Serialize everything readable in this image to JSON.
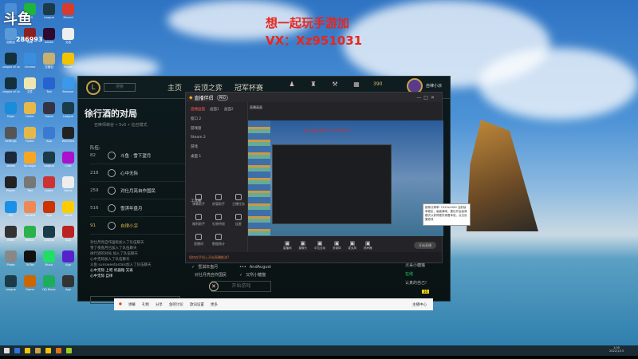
{
  "overlay": {
    "line1": "想一起玩手游加",
    "line2": "VX：Xz951031",
    "channel_logo": "斗鱼",
    "room_number": "286993"
  },
  "desktop": {
    "icons": [
      {
        "label": "此电脑",
        "color": "#4a8fd8"
      },
      {
        "label": "360",
        "color": "#1eb53a"
      },
      {
        "label": "League",
        "color": "#1c3b48"
      },
      {
        "label": "Record",
        "color": "#d83b2c"
      },
      {
        "label": "回收站",
        "color": "#5a9ad8"
      },
      {
        "label": "App",
        "color": "#8a2020"
      },
      {
        "label": "Adobe",
        "color": "#2e0a2f"
      },
      {
        "label": "文档",
        "color": "#eeeeee"
      },
      {
        "label": "League of Legends",
        "color": "#14303a"
      },
      {
        "label": "Chrome",
        "color": "#3b8ede"
      },
      {
        "label": "压缩包",
        "color": "#c8b06e"
      },
      {
        "label": "Player",
        "color": "#f2c300"
      },
      {
        "label": "League of Legends",
        "color": "#14303a"
      },
      {
        "label": "文件",
        "color": "#f0e6b0"
      },
      {
        "label": "Tool",
        "color": "#2463d0"
      },
      {
        "label": "Browser",
        "color": "#3a99e8"
      },
      {
        "label": "Edge",
        "color": "#1b8cd8"
      },
      {
        "label": "Folder",
        "color": "#e6b84a"
      },
      {
        "label": "Game",
        "color": "#334"
      },
      {
        "label": "League",
        "color": "#1c3b48"
      },
      {
        "label": "Settings",
        "color": "#555"
      },
      {
        "label": "Folder",
        "color": "#e6b84a"
      },
      {
        "label": "App",
        "color": "#3a7ad0"
      },
      {
        "label": "WeGame",
        "color": "#222"
      },
      {
        "label": "Steam",
        "color": "#1b2838"
      },
      {
        "label": "Sunlogin",
        "color": "#f6a623"
      },
      {
        "label": "League",
        "color": "#1c3b48"
      },
      {
        "label": "Chat",
        "color": "#a1c"
      },
      {
        "label": "Player",
        "color": "#222"
      },
      {
        "label": "Tool",
        "color": "#777"
      },
      {
        "label": "Audio",
        "color": "#c33"
      },
      {
        "label": "Notes",
        "color": "#eee"
      },
      {
        "label": "QQ",
        "color": "#1a90e8"
      },
      {
        "label": "Camera",
        "color": "#e85"
      },
      {
        "label": "App",
        "color": "#c30"
      },
      {
        "label": "Game",
        "color": "#fc0"
      },
      {
        "label": "Video",
        "color": "#333"
      },
      {
        "label": "Weixin",
        "color": "#2bb24c"
      },
      {
        "label": "League",
        "color": "#1c3b48"
      },
      {
        "label": "App",
        "color": "#b22"
      },
      {
        "label": "Photo",
        "color": "#888"
      },
      {
        "label": "TikTok",
        "color": "#111"
      },
      {
        "label": "Music",
        "color": "#2d6"
      },
      {
        "label": "App",
        "color": "#52c"
      },
      {
        "label": "League",
        "color": "#1c3b48"
      },
      {
        "label": "Game",
        "color": "#c60"
      },
      {
        "label": "QQ Music",
        "color": "#1dae5c"
      },
      {
        "label": "App",
        "color": "#333"
      }
    ]
  },
  "lol": {
    "logo": "L",
    "search_placeholder": "搜索",
    "nav": [
      "主页",
      "云顶之弈",
      "冠军杯赛"
    ],
    "currency": "390",
    "profile_name": "自律小凉",
    "lobby_title": "徐行酒的对局",
    "lobby_sub": "召唤师峡谷 • 5v5 • 征召模式",
    "team_label": "队伍:",
    "members": [
      {
        "level": "82",
        "name": "斗鱼 · 雪下望月"
      },
      {
        "level": "218",
        "name": "心中无际"
      },
      {
        "level": "259",
        "name": "对仕月亮自作国民"
      },
      {
        "level": "516",
        "name": "雪淇年盘月"
      },
      {
        "level": "91",
        "name": "自律小凉"
      }
    ],
    "chat": [
      "对仕月亮自作国民加入了队伍聊天",
      "雪了夜盘月已加入了队伍聊天",
      "徐行酒的对局 加入了队伍聊天",
      "心中无际加入了队伍聊天",
      "斗鱼 sunsweetostals加入了队伍聊天",
      "心中无际 上吧 机器账 又再",
      "心中无际 自律"
    ],
    "invites": [
      {
        "mark": "✓",
        "name": "雪淇年盘月"
      },
      {
        "mark": "•••",
        "name": "AndAugust"
      },
      {
        "mark": "",
        "name": "对仕月亮自作国民"
      },
      {
        "mark": "✓",
        "name": "又所小糖猫"
      }
    ],
    "start_label": "开始游戏",
    "close_glyph": "✕",
    "friends": [
      "灵哥小糖猫",
      "在线",
      "认真的自己!"
    ],
    "notify_count": "10"
  },
  "stream": {
    "title": "直播伴侣",
    "badge": "PRO",
    "tabs": [
      "直播画面",
      "画面1",
      "画面2"
    ],
    "scenes": [
      "窗口 2",
      "游戏窗",
      "Steam 2",
      "游戏",
      "桌面 1"
    ],
    "tools_label": "工具箱",
    "tools": [
      "弹幕助手",
      "房管助手",
      "主播任务",
      "福利助手",
      "礼物特效",
      "连麦",
      "直播间",
      "数据统计"
    ],
    "controls": [
      "直播间",
      "摄像头",
      "中位互动",
      "多媒体",
      "麦克风",
      "扬声器"
    ],
    "go_live": "开始直播",
    "status": "如何在手机上开启直播推流?",
    "preview_overlay": "想一起玩手游加 VX: Xz951031",
    "tip": "推荐分辨率: 1920x1080 当前帧率稳定，画面清晰，建议开启高清模式以获得更好观看体验，点击设置修改"
  },
  "bar": {
    "items": [
      "弹幕",
      "礼物",
      "分享",
      "鱼吧讨论",
      "歌词设置",
      "更多"
    ],
    "right": "主播中心"
  },
  "taskbar": {
    "apps": [
      "#ddd",
      "#2f73d8",
      "#f2c300",
      "#c7a34a",
      "#f2c300",
      "#e07020",
      "#9c2"
    ],
    "time": "1:00",
    "date": "2022/1/13"
  }
}
